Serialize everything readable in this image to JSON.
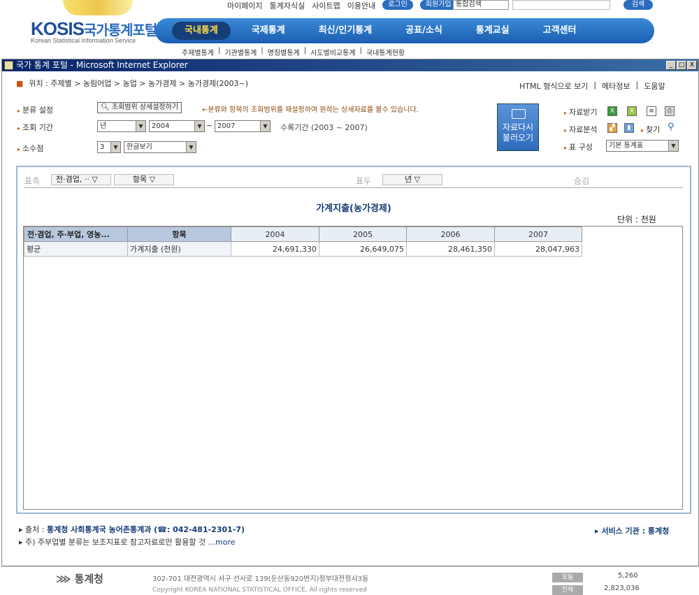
{
  "site": {
    "logo_main": "KOSIS",
    "logo_kr": "국가통계포털",
    "logo_sub": "Korean Statistical Information Service",
    "util_links": [
      "마이페이지",
      "통계자식실",
      "사이트맵",
      "이용안내"
    ],
    "login": "로그인",
    "join": "회원가입",
    "search_scope": "통합검색",
    "search_button": "검색",
    "nav": [
      "국내통계",
      "국제통계",
      "최신/인기통계",
      "공표/소식",
      "통계교실",
      "고객센터"
    ],
    "sub_nav": [
      "주제별통계",
      "기관별통계",
      "명칭별통계",
      "시도별비교통계",
      "국내통계현황"
    ]
  },
  "window": {
    "title": "국가 통계 포털 - Microsoft Internet Explorer",
    "min": "_",
    "max": "□",
    "close": "X"
  },
  "breadcrumb": "위치 :  주제별 > 농림어업 > 농업 > 농가경제 > 농가경제(2003~)",
  "top_links": [
    "HTML 형식으로 보기",
    "메타정보",
    "도움말"
  ],
  "options": {
    "category_label": "분류 설정",
    "range_button": "조회범위 상세설정하기",
    "range_hint": "←분류와 항목의 조회범위를 재설정하여 원하는 상세자료를 볼수 있습니다.",
    "period_label": "조회 기간",
    "period_unit": "년",
    "period_from": "2004",
    "period_sep": "~",
    "period_to": "2007",
    "period_note": "수록기간 (2003 ~ 2007)",
    "decimal_label": "소수점",
    "decimal_value": "3",
    "view_mode": "한글보기",
    "reload_button": "자료다시 불러오기",
    "download_label": "자료받기",
    "analysis_label": "자료분석",
    "find_label": "찾기",
    "table_config_label": "표 구성",
    "table_config_value": "기본 통계표"
  },
  "axes": {
    "stub_label": "표측",
    "stub_chip1": "전·겸업, ··",
    "stub_chip2": "항목",
    "head_label": "표두",
    "head_chip": "년",
    "hidden_label": "숨김"
  },
  "table": {
    "title": "가계지출(농가경제)",
    "unit": "단위 : 천원",
    "dim_headers": [
      "전·겸업, 주·부업, 영농...",
      "항목"
    ],
    "years": [
      "2004",
      "2005",
      "2006",
      "2007"
    ],
    "rows": [
      {
        "group": "평균",
        "item": "가계지출 (천원)",
        "values": [
          "24,691,330",
          "26,649,075",
          "28,461,350",
          "28,047,963"
        ]
      }
    ]
  },
  "footer_page": {
    "source_prefix": "출처 : ",
    "source": "통계청 사회통계국 농어촌통계과 (☎: 042-481-2301-7)",
    "note": "주) 주부업별 분류는 보조지표로 참고자료로만 활용할 것",
    "more": "...more",
    "service_org": "서비스 기관 : 통계청"
  },
  "site_footer": {
    "org": "통계청",
    "address": "302-701 대전광역시 서구 선사로 139(둔산동920번지)정부대전청사3동",
    "copyright": "Copyright KOREA NATIONAL STATISTICAL OFFICE. All rights reserved",
    "today_label": "오늘",
    "today_value": "5,260",
    "total_label": "전체",
    "total_value": "2,823,036"
  }
}
